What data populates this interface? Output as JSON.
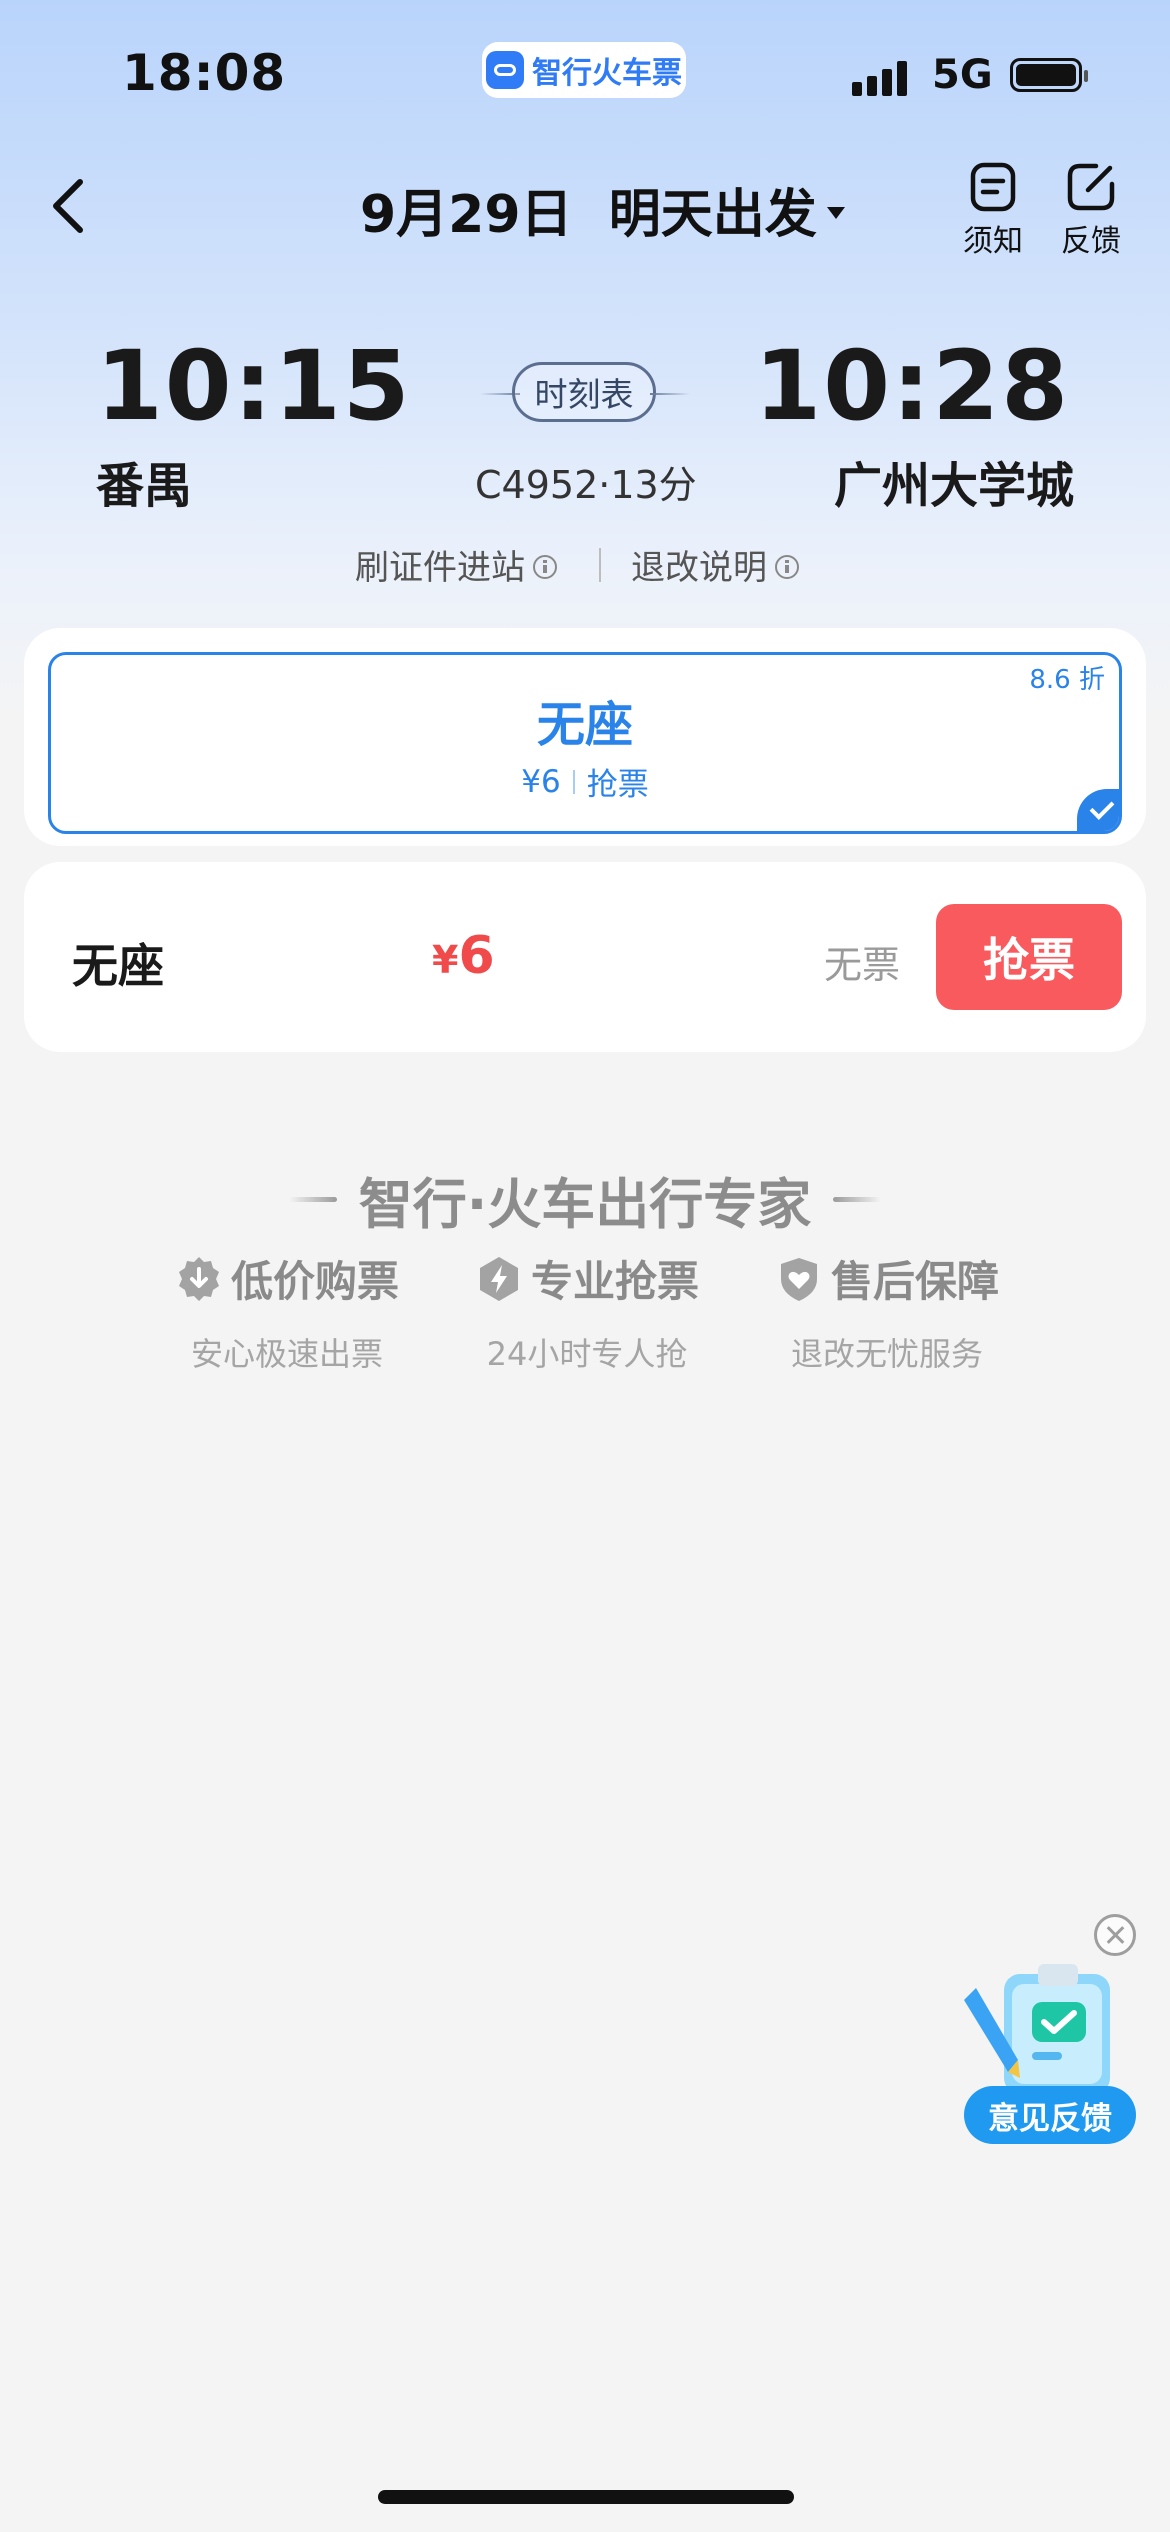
{
  "status_bar": {
    "time": "18:08",
    "app_badge": "智行火车票",
    "network": "5G",
    "icons": [
      "signal-icon",
      "battery-icon"
    ]
  },
  "nav": {
    "title": "9月29日  明天出发",
    "notice_label": "须知",
    "feedback_label": "反馈",
    "icons": [
      "back-arrow-icon",
      "chevron-down-icon",
      "notice-icon",
      "edit-icon"
    ]
  },
  "trip": {
    "depart_time": "10:15",
    "depart_station": "番禺",
    "arrive_time": "10:28",
    "arrive_station": "广州大学城",
    "schedule_label": "时刻表",
    "train_meta": "C4952·13分",
    "id_entry_label": "刷证件进站",
    "refund_label": "退改说明"
  },
  "seat_selector": {
    "selected": {
      "name": "无座",
      "price": "¥6",
      "action": "抢票",
      "discount": "8.6 折"
    }
  },
  "ticket_rows": [
    {
      "seat": "无座",
      "currency": "¥",
      "price": "6",
      "availability": "无票",
      "button": "抢票"
    }
  ],
  "promo": {
    "title": "智行·火车出行专家",
    "features": [
      {
        "title": "低价购票",
        "desc": "安心极速出票",
        "icon": "download-badge-icon"
      },
      {
        "title": "专业抢票",
        "desc": "24小时专人抢",
        "icon": "lightning-hex-icon"
      },
      {
        "title": "售后保障",
        "desc": "退改无忧服务",
        "icon": "shield-heart-icon"
      }
    ]
  },
  "feedback_float": {
    "label": "意见反馈",
    "icons": [
      "close-icon",
      "clipboard-check-icon"
    ]
  },
  "colors": {
    "accent_blue": "#2a83e8",
    "price_red": "#f04a4a",
    "grab_button": "#f95a5e",
    "header_gradient_top": "#b9d4fb",
    "page_bg": "#f4f4f5"
  }
}
